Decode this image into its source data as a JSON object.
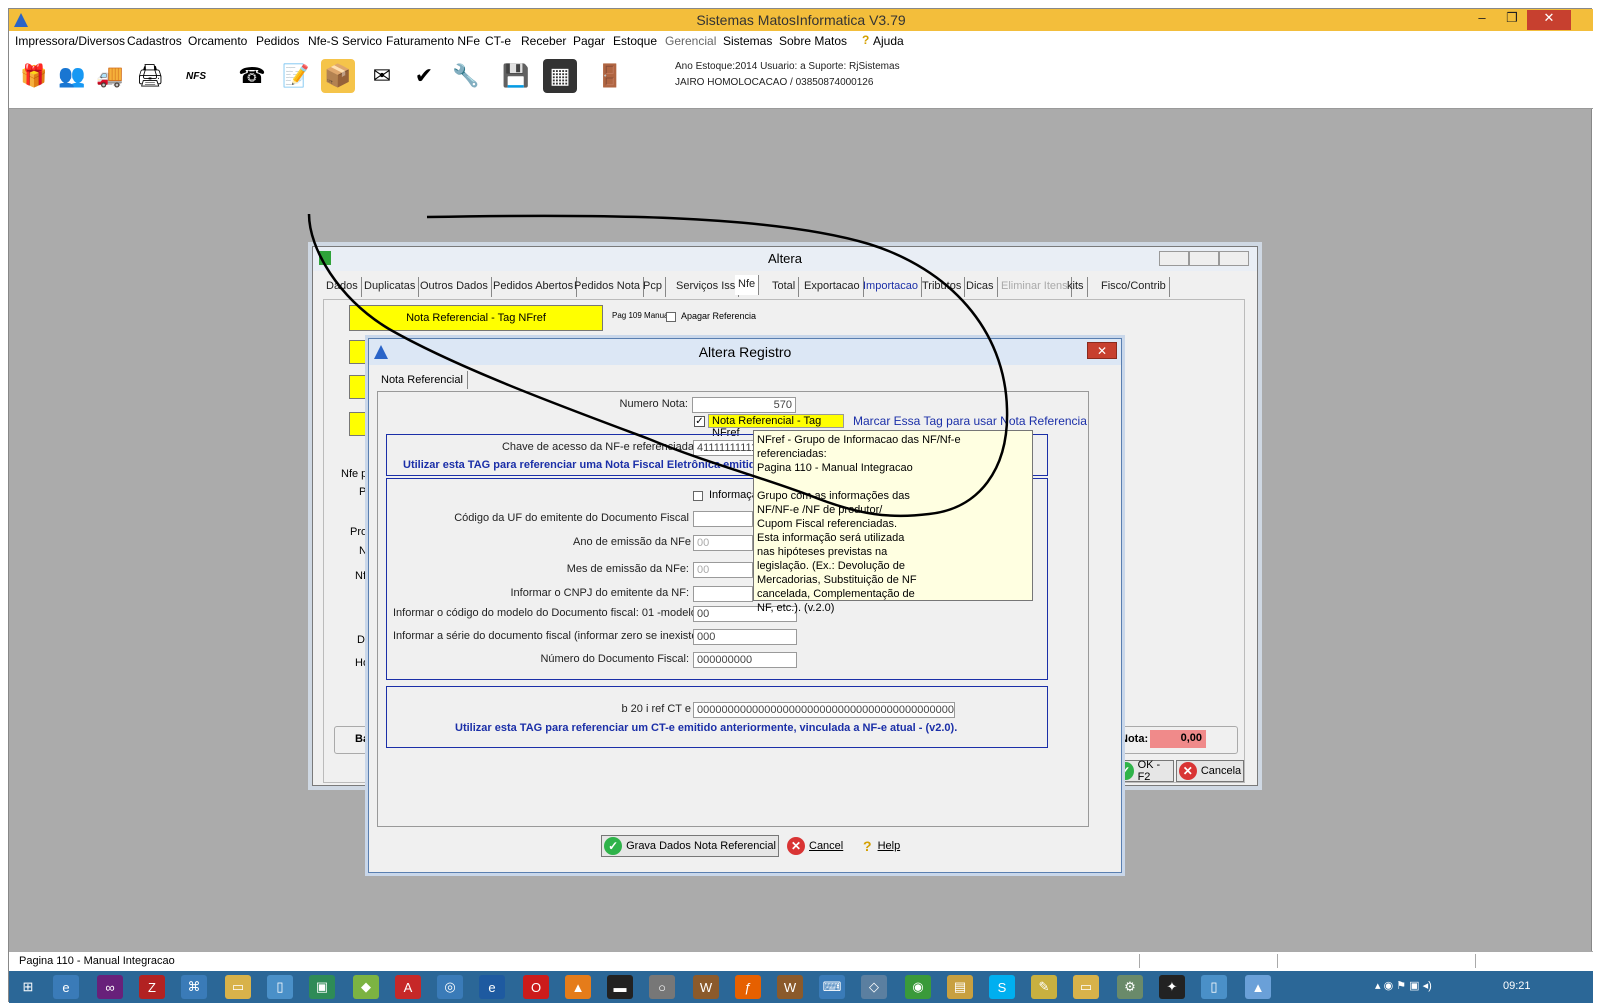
{
  "app": {
    "title": "Sistemas MatosInformatica V3.79",
    "info_line1": "Ano Estoque:2014 Usuario: a Suporte: RjSistemas",
    "info_line2": "JAIRO HOMOLOCACAO / 03850874000126",
    "window_controls": {
      "minimize": "–",
      "restore": "❐",
      "close": "✕"
    }
  },
  "menu": [
    "Impressora/Diversos",
    "Cadastros",
    "Orcamento",
    "Pedidos",
    "Nfe-S Servico",
    "Faturamento NFe",
    "CT-e",
    "Receber",
    "Pagar",
    "Estoque",
    "Gerencial",
    "Sistemas",
    "Sobre Matos",
    "Ajuda"
  ],
  "toolbar_icons": [
    {
      "name": "gift-icon",
      "glyph": "🎁"
    },
    {
      "name": "users-icon",
      "glyph": "👥"
    },
    {
      "name": "truck-icon",
      "glyph": "🚚"
    },
    {
      "name": "printer-icon",
      "glyph": "🖨"
    },
    {
      "name": "nfs-icon",
      "glyph": "NFS"
    },
    {
      "name": "phone-icon",
      "glyph": "☎"
    },
    {
      "name": "document-edit-icon",
      "glyph": "📝"
    },
    {
      "name": "boxes-icon",
      "glyph": "📦"
    },
    {
      "name": "email-icon",
      "glyph": "✉"
    },
    {
      "name": "checklist-icon",
      "glyph": "✔"
    },
    {
      "name": "tools-icon",
      "glyph": "🔧"
    },
    {
      "name": "save-icon",
      "glyph": "💾"
    },
    {
      "name": "calculator-icon",
      "glyph": "▦"
    },
    {
      "name": "exit-icon",
      "glyph": "🚪"
    }
  ],
  "altera": {
    "title": "Altera",
    "tabs": [
      "Dados",
      "Duplicatas",
      "Outros Dados",
      "Pedidos Abertos",
      "Pedidos Nota",
      "Pcp",
      "Serviços Iss",
      "Nfe",
      "Total",
      "Exportacao",
      "Importacao",
      "Tributos",
      "Dicas",
      "Eliminar Itens",
      "kits",
      "Fisco/Contrib"
    ],
    "nota_ref_button": "Nota Referencial - Tag NFref",
    "pag_label": "Pag 109 Manual",
    "apagar_label": "Apagar Referencia",
    "left_labels": [
      "Nfe p",
      "Pr",
      "Prot",
      "N",
      "Nf",
      "D",
      "Ho"
    ],
    "bottom_left": "Ba",
    "nota_label": "Nota:",
    "nota_value": "0,00",
    "ok_label": "OK - F2",
    "cancela_label": "Cancela"
  },
  "dialog": {
    "title": "Altera Registro",
    "close_glyph": "✕",
    "tab": "Nota Referencial",
    "numero_nota_label": "Numero Nota:",
    "numero_nota_value": "570",
    "nfref_checkbox_label": "Nota Referencial - Tag NFref",
    "nfref_hint": "Marcar Essa Tag para usar Nota Referencia",
    "chave_label": "Chave de acesso da NF-e referenciada:",
    "chave_value": "41111111111",
    "util_nfe": "Utilizar esta TAG para referenciar uma Nota Fiscal Eletrônica emitid",
    "informacao_label": "Informaçã",
    "cuf_label": "Código da UF do emitente do Documento Fiscal",
    "ano_label": "Ano de emissão da NFe",
    "ano_value": "00",
    "mes_label": "Mes de emissão da NFe:",
    "mes_value": "00",
    "cnpj_label": "Informar o CNPJ do emitente da NF:",
    "modelo_label": "Informar o código do modelo do Documento fiscal: 01 -modelo 01 :",
    "modelo_value": "00",
    "serie_label": "Informar a série do documento fiscal (informar zero se inexistente):",
    "serie_value": "000",
    "numero_doc_label": "Número do Documento Fiscal:",
    "numero_doc_value": "000000000",
    "cte_label": "b 20 i ref CT e",
    "cte_value": "00000000000000000000000000000000000000000000",
    "util_cte": "Utilizar esta TAG para referenciar um CT-e emitido anteriormente, vinculada a NF-e atual - (v2.0).",
    "grava_button": "Grava Dados Nota Referencial",
    "cancel_button": "Cancel",
    "help_button": "Help"
  },
  "tooltip": [
    "NFref - Grupo de Informacao das NF/Nf-e referenciadas:",
    "Pagina 110 - Manual Integracao",
    "",
    "Grupo com as informações das",
    "NF/NF-e /NF de produtor/",
    "Cupom Fiscal referenciadas.",
    "Esta informação será utilizada",
    "nas hipóteses previstas na",
    "legislação. (Ex.: Devolução de",
    "Mercadorias, Substituição de NF",
    "cancelada, Complementação de",
    "NF, etc.). (v.2.0)"
  ],
  "statusbar": {
    "text": "Pagina 110 - Manual Integracao"
  },
  "taskbar": {
    "clock": "09:21",
    "icons": [
      "windows-start-icon",
      "ie-icon",
      "visual-studio-icon",
      "filezilla-icon",
      "network-icon",
      "folder-icon",
      "notepad-icon",
      "terminal-icon",
      "android-icon",
      "acrobat-icon",
      "mail-icon",
      "edge-icon",
      "opera-icon",
      "app-icon",
      "cmd-icon",
      "disc-icon",
      "winrar-icon",
      "firefox-icon",
      "winrar2-icon",
      "keyboard-icon",
      "box-icon",
      "chrome-icon",
      "calendar-icon",
      "skype-icon",
      "notes-icon",
      "explorer-icon",
      "tools2-icon",
      "pdf-icon",
      "calc-icon",
      "matos-icon"
    ]
  },
  "colors": {
    "titlebar": "#f3be3b",
    "highlight": "#ffff00",
    "blue_text": "#1b2fa8",
    "nota_bg": "#f08a8a",
    "taskbar": "#2b6797"
  }
}
